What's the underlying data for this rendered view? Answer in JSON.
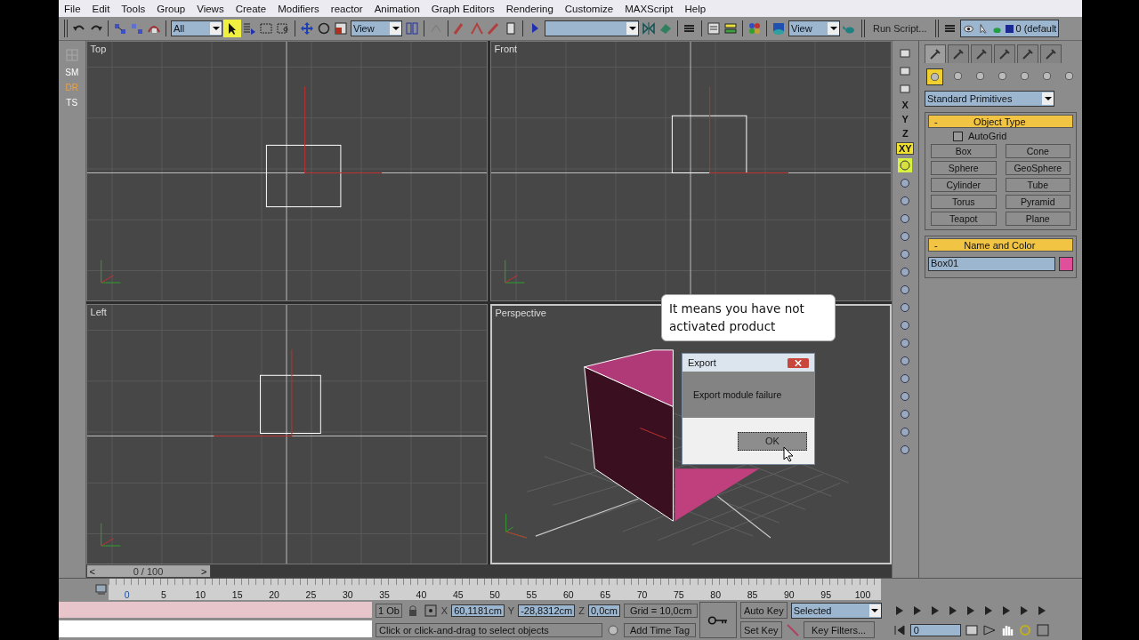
{
  "menu": [
    "File",
    "Edit",
    "Tools",
    "Group",
    "Views",
    "Create",
    "Modifiers",
    "reactor",
    "Animation",
    "Graph Editors",
    "Rendering",
    "Customize",
    "MAXScript",
    "Help"
  ],
  "toolbar": {
    "selection_filter": "All",
    "select_tool_on": true,
    "reference_coordinates": "View",
    "render_view": "View",
    "run_script": "Run Script...",
    "layer": "0 (default"
  },
  "left_strip": [
    {
      "label": "SM",
      "color": "#ffffff"
    },
    {
      "label": "DR",
      "color": "#f0a040"
    },
    {
      "label": "TS",
      "color": "#ffffff"
    }
  ],
  "viewports": [
    {
      "label": "Top",
      "kind": "top",
      "active": false
    },
    {
      "label": "Front",
      "kind": "front",
      "active": false
    },
    {
      "label": "Left",
      "kind": "left",
      "active": false
    },
    {
      "label": "Perspective",
      "kind": "perspective",
      "active": true
    }
  ],
  "axis_constraints": [
    {
      "label": "X",
      "selected": false
    },
    {
      "label": "Y",
      "selected": false
    },
    {
      "label": "Z",
      "selected": false
    },
    {
      "label": "XY",
      "selected": true
    }
  ],
  "command_panel": {
    "tabs": [
      {
        "selected": true
      },
      {
        "selected": false
      },
      {
        "selected": false
      },
      {
        "selected": false
      },
      {
        "selected": false
      },
      {
        "selected": false
      }
    ],
    "categories": [
      {
        "selected": true
      },
      {
        "selected": false
      },
      {
        "selected": false
      },
      {
        "selected": false
      },
      {
        "selected": false
      },
      {
        "selected": false
      },
      {
        "selected": false
      }
    ],
    "object_category": "Standard Primitives",
    "object_type": {
      "collapse": "-",
      "title": "Object Type",
      "autogrid": {
        "label": "AutoGrid",
        "checked": false
      },
      "buttons": [
        "Box",
        "Cone",
        "Sphere",
        "GeoSphere",
        "Cylinder",
        "Tube",
        "Torus",
        "Pyramid",
        "Teapot",
        "Plane"
      ]
    },
    "name_and_color": {
      "collapse": "-",
      "title": "Name and Color",
      "name": "Box01",
      "color": "#e0509a"
    }
  },
  "frame_slider": {
    "prev": "<",
    "label": "0 / 100",
    "next": ">",
    "level": 0
  },
  "timeline": {
    "ticks": [
      "0",
      "5",
      "10",
      "15",
      "20",
      "25",
      "30",
      "35",
      "40",
      "45",
      "50",
      "55",
      "60",
      "65",
      "70",
      "75",
      "80",
      "85",
      "90",
      "95",
      "100"
    ]
  },
  "status": {
    "selection_count": "1 Ob",
    "x_label": "X",
    "x": "60,1181cm",
    "y_label": "Y",
    "y": "-28,8312cm",
    "z_label": "Z",
    "z": "0,0cm",
    "grid": "Grid = 10,0cm",
    "prompt": "Click or click-and-drag to select objects",
    "time_tag": "Add Time Tag",
    "auto_key": "Auto Key",
    "set_key": "Set Key",
    "key_mode": "Selected",
    "key_filters": "Key Filters...",
    "frame": "0"
  },
  "callout": "It means you have not activated product",
  "dialog": {
    "title": "Export",
    "message": "Export module failure",
    "button": "OK"
  }
}
